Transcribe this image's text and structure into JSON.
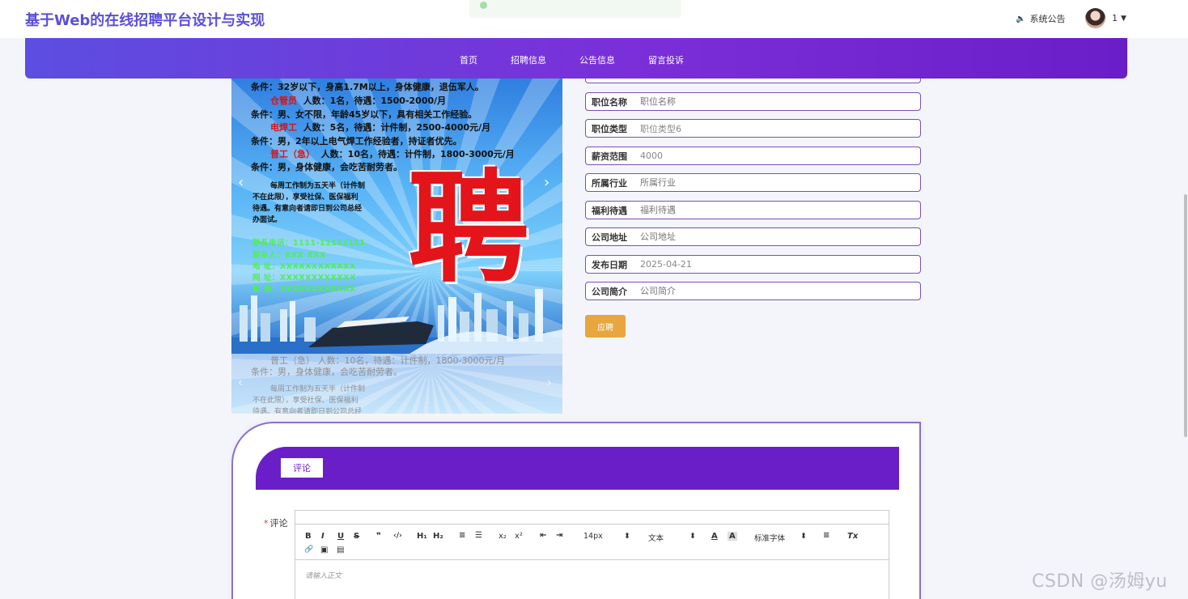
{
  "header": {
    "site_title": "基于Web的在线招聘平台设计与实现",
    "notice_label": "系统公告",
    "user_name": "1"
  },
  "nav": {
    "items": [
      "首页",
      "招聘信息",
      "公告信息",
      "留言投诉"
    ]
  },
  "poster": {
    "line1": "条件：32岁以下，身高1.7M以上，身体健康，退伍军人。",
    "line2_title": "仓管员",
    "line2_text": "人数：1名，待遇：1500-2000/月",
    "line3": "条件：男、女不限，年龄45岁以下，具有相关工作经验。",
    "line4_title": "电焊工",
    "line4_text": "人数：5名，待遇：计件制，2500-4000元/月",
    "line5": "条件：男，2年以上电气焊工作经验者，持证者优先。",
    "line6_title": "普工（急）",
    "line6_text": "人数：10名，待遇：计件制，1800-3000元/月",
    "line7": "条件：男，身体健康，会吃苦耐劳者。",
    "small1": "每周工作制为五天半（计件制",
    "small2": "不在此限），享受社保、医保福利",
    "small3": "待遇。有意向者请即日到公司总经",
    "small4": "办面试。",
    "contact1": "联系电话：1111-11111111",
    "contact2": "联系人：XXX  XXX",
    "contact3": "地  址：XXXXXXXXXXXX",
    "contact4": "网  址：XXXXXXXXXXXX",
    "contact5": "邮  箱：XXXXXXXXXXXX",
    "big_char": "聘",
    "second_line1": "普工（急）  人数：10名，待遇：计件制，1800-3000元/月",
    "second_line2": "条件：男，身体健康，会吃苦耐劳者。",
    "second_small1": "每周工作制为五天半（计件制",
    "second_small2": "不在此限），享受社保、医保福利",
    "second_small3": "待遇。有意向者请即日到公司总经",
    "arrow_left": "‹",
    "arrow_right": "›"
  },
  "form": {
    "fields": [
      {
        "label": "职位名称",
        "value": "",
        "placeholder": "职位名称"
      },
      {
        "label": "职位类型",
        "value": "职位类型6",
        "placeholder": "职位类型"
      },
      {
        "label": "薪资范围",
        "value": "4000",
        "placeholder": "薪资范围"
      },
      {
        "label": "所属行业",
        "value": "",
        "placeholder": "所属行业"
      },
      {
        "label": "福利待遇",
        "value": "",
        "placeholder": "福利待遇"
      },
      {
        "label": "公司地址",
        "value": "",
        "placeholder": "公司地址"
      },
      {
        "label": "发布日期",
        "value": "2025-04-21",
        "placeholder": "发布日期"
      },
      {
        "label": "公司简介",
        "value": "",
        "placeholder": "公司简介"
      }
    ],
    "apply_label": "应聘"
  },
  "comment": {
    "tab_label": "评论",
    "field_label": "评论",
    "required_mark": "*",
    "editor_placeholder": "请输入正文",
    "toolbar": {
      "bold": "B",
      "italic": "I",
      "underline": "U",
      "strike": "S",
      "quote": "❞",
      "code": "‹/›",
      "h1": "H₁",
      "h2": "H₂",
      "ordered_list": "≡",
      "bullet_list": "☰",
      "subscript": "x₂",
      "superscript": "x²",
      "outdent": "⇤",
      "indent": "⇥",
      "size_value": "14px",
      "format_value": "文本",
      "font_color": "A",
      "bg_color": "A",
      "font_family_value": "标准字体",
      "align": "≡",
      "clean": "Tx",
      "link": "🔗",
      "image": "▣",
      "video": "▤",
      "select_arrow": "⬍"
    }
  },
  "watermark": "CSDN @汤姆yu"
}
